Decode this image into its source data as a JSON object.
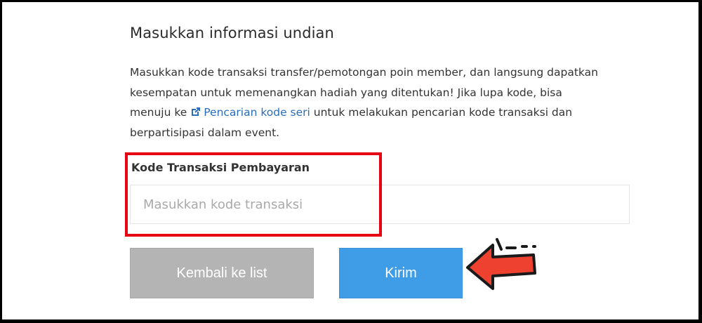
{
  "form": {
    "title": "Masukkan informasi undian",
    "description": {
      "line1": "Masukkan kode transaksi transfer/pemotongan poin member, dan langsung dapatkan",
      "line2": "kesempatan untuk memenangkan hadiah yang ditentukan! Jika lupa kode, bisa",
      "line3_before": "menuju ke ",
      "line3_link": "Pencarian kode seri",
      "line3_after": " untuk melakukan pencarian kode transaksi dan",
      "line4": "berpartisipasi dalam event."
    },
    "field_label": "Kode Transaksi Pembayaran",
    "input_value": "",
    "input_placeholder": "Masukkan kode transaksi",
    "back_button": "Kembali ke list",
    "submit_button": "Kirim"
  },
  "icons": {
    "link_icon": "external-link-icon",
    "annotation_arrow": "arrow-left-icon"
  },
  "colors": {
    "link": "#2a6ebb",
    "highlight": "#e60012",
    "submit_button": "#3f9de8",
    "back_button": "#b4b4b4",
    "arrow": "#ef4130"
  }
}
